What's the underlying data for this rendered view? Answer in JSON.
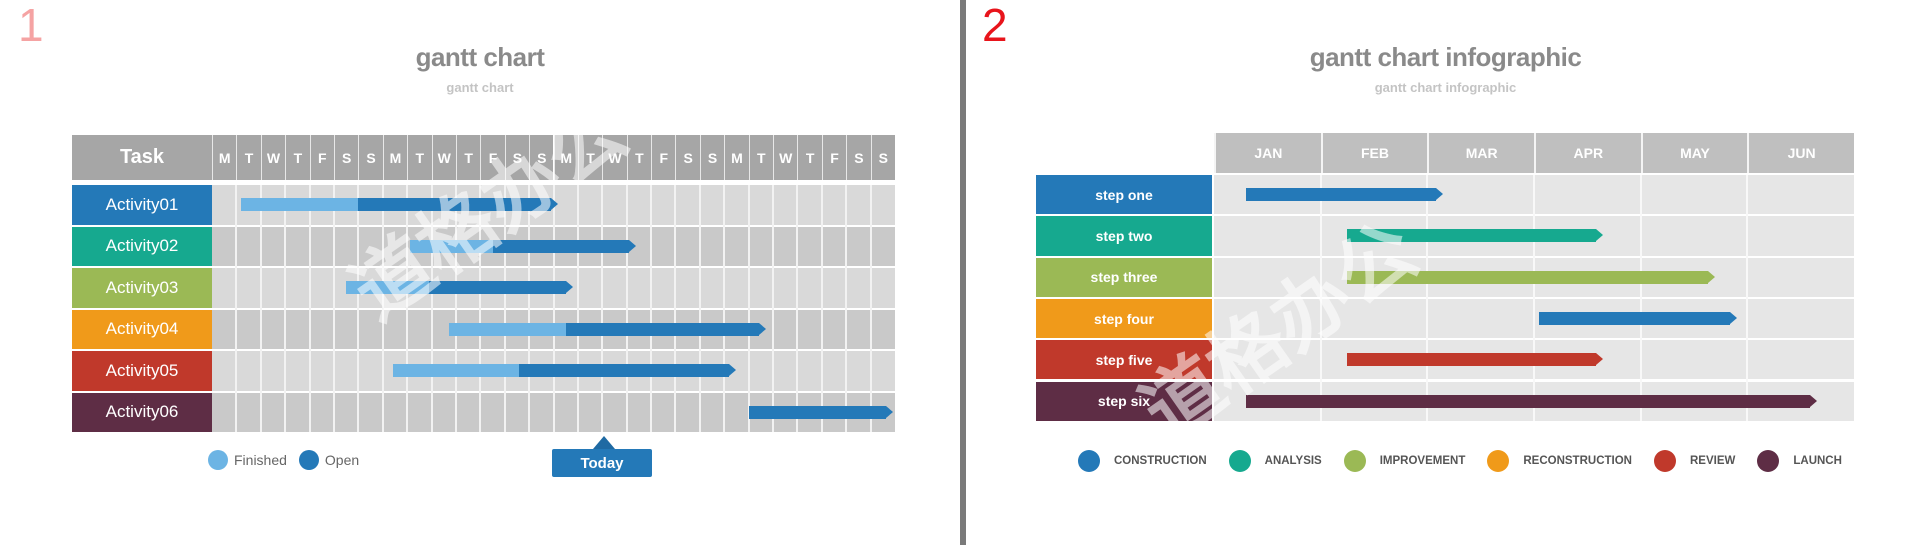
{
  "panels": [
    {
      "number": "1",
      "title": "gantt chart",
      "subtitle": "gantt chart"
    },
    {
      "number": "2",
      "title": "gantt chart infographic",
      "subtitle": "gantt chart infographic"
    }
  ],
  "chart_data": [
    {
      "type": "gantt",
      "title": "gantt chart",
      "subtitle": "gantt chart",
      "task_header": "Task",
      "x_unit": "day",
      "x_ticks": [
        "M",
        "T",
        "W",
        "T",
        "F",
        "S",
        "S",
        "M",
        "T",
        "W",
        "T",
        "F",
        "S",
        "S",
        "M",
        "T",
        "W",
        "T",
        "F",
        "S",
        "S",
        "M",
        "T",
        "W",
        "T",
        "F",
        "S",
        "S"
      ],
      "xlim": [
        0,
        28
      ],
      "tasks": [
        {
          "name": "Activity01",
          "color": "#2479b8",
          "start": 1.2,
          "finished_end": 6.0,
          "end": 14.2
        },
        {
          "name": "Activity02",
          "color": "#16a98f",
          "start": 8.1,
          "finished_end": 11.5,
          "end": 17.4
        },
        {
          "name": "Activity03",
          "color": "#9bb955",
          "start": 5.5,
          "finished_end": 8.9,
          "end": 14.8
        },
        {
          "name": "Activity04",
          "color": "#f09a1a",
          "start": 9.7,
          "finished_end": 14.5,
          "end": 22.7
        },
        {
          "name": "Activity05",
          "color": "#c0392b",
          "start": 7.4,
          "finished_end": 12.6,
          "end": 21.5
        },
        {
          "name": "Activity06",
          "color": "#5e2d45",
          "start": 22.0,
          "finished_end": 22.0,
          "end": 27.9
        }
      ],
      "legend": [
        {
          "label": "Finished",
          "color": "#6cb4e4"
        },
        {
          "label": "Open",
          "color": "#2479b8"
        }
      ],
      "today": {
        "label": "Today",
        "position": 16.0
      }
    },
    {
      "type": "gantt",
      "title": "gantt chart infographic",
      "subtitle": "gantt chart infographic",
      "x_unit": "month",
      "x_ticks": [
        "JAN",
        "FEB",
        "MAR",
        "APR",
        "MAY",
        "JUN"
      ],
      "xlim": [
        0,
        6
      ],
      "tasks": [
        {
          "name": "step one",
          "color": "#2479b8",
          "start": 0.3,
          "end": 2.15
        },
        {
          "name": "step two",
          "color": "#16a98f",
          "start": 1.25,
          "end": 3.65
        },
        {
          "name": "step three",
          "color": "#9bb955",
          "start": 1.25,
          "end": 4.7
        },
        {
          "name": "step four",
          "color": "#2479b8",
          "label_color": "#f09a1a",
          "start": 3.05,
          "end": 4.9
        },
        {
          "name": "step five",
          "color": "#c0392b",
          "start": 1.25,
          "end": 3.65
        },
        {
          "name": "step six",
          "color": "#5e2d45",
          "start": 0.3,
          "end": 5.65
        }
      ],
      "legend": [
        {
          "label": "CONSTRUCTION",
          "color": "#2479b8"
        },
        {
          "label": "ANALYSIS",
          "color": "#16a98f"
        },
        {
          "label": "IMPROVEMENT",
          "color": "#9bb955"
        },
        {
          "label": "RECONSTRUCTION",
          "color": "#f09a1a"
        },
        {
          "label": "REVIEW",
          "color": "#c0392b"
        },
        {
          "label": "LAUNCH",
          "color": "#5e2d45"
        }
      ]
    }
  ],
  "watermark": "道格办公"
}
